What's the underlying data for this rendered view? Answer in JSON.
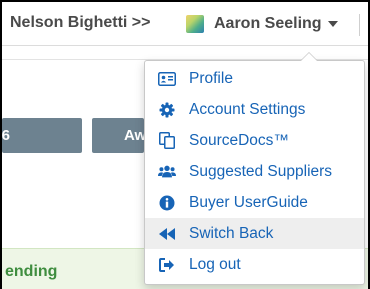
{
  "topbar": {
    "breadcrumb": "Nelson Bighetti >>",
    "user_name": "Aaron Seeling"
  },
  "background": {
    "button_left_label": "6",
    "button_mid_label": "Aw",
    "status_text": "ending"
  },
  "menu": {
    "items": [
      {
        "label": "Profile",
        "icon": "id-card-icon"
      },
      {
        "label": "Account Settings",
        "icon": "gear-icon"
      },
      {
        "label": "SourceDocs™",
        "icon": "copy-docs-icon"
      },
      {
        "label": "Suggested Suppliers",
        "icon": "users-icon"
      },
      {
        "label": "Buyer UserGuide",
        "icon": "info-circle-icon"
      },
      {
        "label": "Switch Back",
        "icon": "backward-icon"
      },
      {
        "label": "Log out",
        "icon": "sign-out-icon"
      }
    ],
    "highlighted_item": "Switch Back"
  },
  "colors": {
    "link": "#1764b6",
    "button": "#6d8290",
    "status_green": "#3f8d3f"
  }
}
